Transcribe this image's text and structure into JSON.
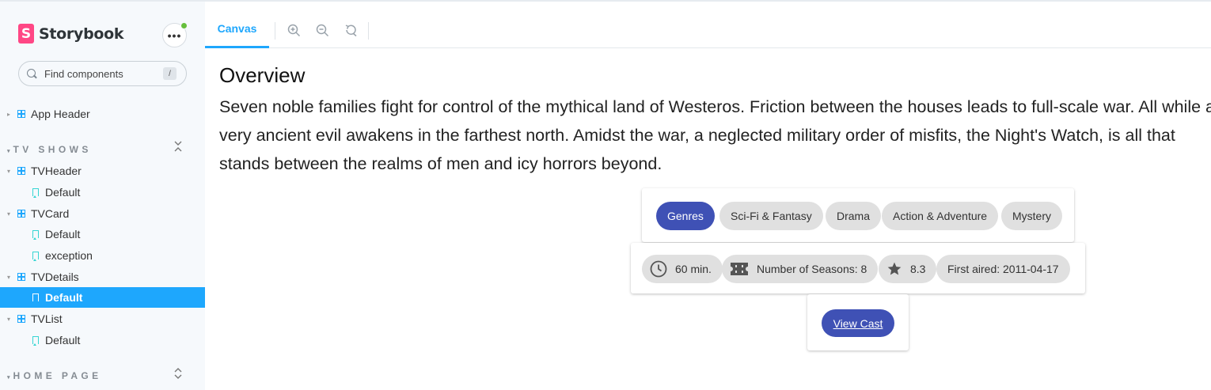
{
  "sidebar": {
    "brand": "Storybook",
    "logo_letter": "S",
    "menu_label": "•••",
    "search_placeholder": "Find components",
    "search_shortcut": "/",
    "app_header": "App Header",
    "sections": [
      {
        "title": "TV SHOWS",
        "toggle": "⌃"
      },
      {
        "title": "HOME PAGE",
        "toggle": "⌃"
      }
    ],
    "tree": [
      {
        "label": "TVHeader",
        "type": "component"
      },
      {
        "label": "Default",
        "type": "story"
      },
      {
        "label": "TVCard",
        "type": "component"
      },
      {
        "label": "Default",
        "type": "story"
      },
      {
        "label": "exception",
        "type": "story"
      },
      {
        "label": "TVDetails",
        "type": "component"
      },
      {
        "label": "Default",
        "type": "story",
        "selected": true
      },
      {
        "label": "TVList",
        "type": "component"
      },
      {
        "label": "Default",
        "type": "story"
      }
    ]
  },
  "toolbar": {
    "canvas_tab": "Canvas",
    "tools": [
      "zoom-in-icon",
      "zoom-out-icon",
      "reset-zoom-icon"
    ]
  },
  "main": {
    "title": "Overview",
    "description": "Seven noble families fight for control of the mythical land of Westeros. Friction between the houses leads to full-scale war. All while a very ancient evil awakens in the farthest north. Amidst the war, a neglected military order of misfits, the Night's Watch, is all that stands between the realms of men and icy horrors beyond.",
    "genres_label": "Genres",
    "genres": [
      "Sci-Fi & Fantasy",
      "Drama",
      "Action & Adventure",
      "Mystery"
    ],
    "runtime": "60 min.",
    "seasons": "Number of Seasons: 8",
    "rating": "8.3",
    "first_aired": "First aired: 2011-04-17",
    "view_cast": "View Cast"
  },
  "colors": {
    "accent": "#1ea7fd",
    "primary_chip": "#3f51b5",
    "chip_bg": "#e0e0e0",
    "brand": "#ff4785"
  }
}
